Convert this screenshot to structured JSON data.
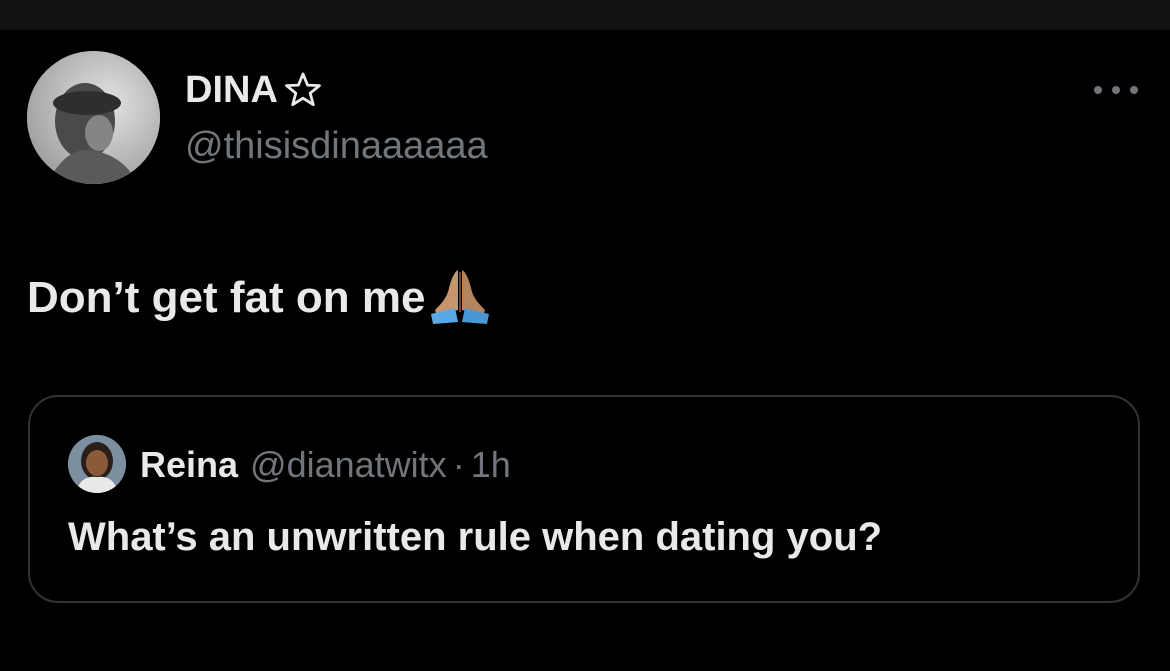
{
  "tweet": {
    "display_name": "DINA",
    "star_icon": "star-outline-icon",
    "handle": "@thisisdinaaaaaa",
    "text": "Don’t get fat on me",
    "emoji_icon": "folded-hands-icon",
    "more_icon": "more-horizontal-icon"
  },
  "quote": {
    "name": "Reina",
    "handle": "@dianatwitx",
    "separator": "·",
    "time": "1h",
    "text": "What’s an unwritten rule when dating you?"
  },
  "colors": {
    "background": "#000000",
    "primary_text": "#e7e9ea",
    "secondary_text": "#71767b",
    "border": "#2f3336"
  }
}
